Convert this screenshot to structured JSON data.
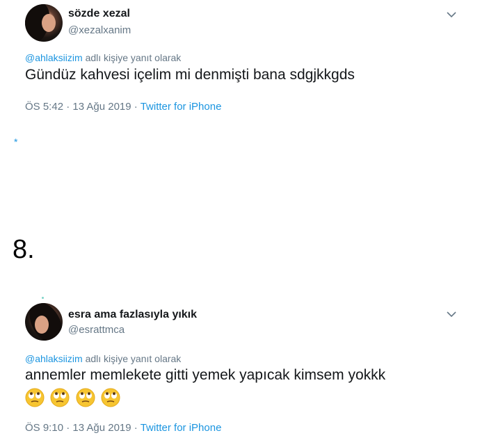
{
  "tweets": [
    {
      "name": "sözde xezal",
      "handle": "@xezalxanim",
      "reply_mention": "@ahlaksiizim",
      "reply_suffix": " adlı kişiye yanıt olarak",
      "text": "Gündüz kahvesi içelim mi denmişti bana sdgjkkgds",
      "time": "ÖS 5:42 · 13 Ağu 2019 · ",
      "source": "Twitter for iPhone"
    },
    {
      "name": "esra ama fazlasıyla yıkık",
      "handle": "@esrattmca",
      "reply_mention": "@ahlaksiizim",
      "reply_suffix": " adlı kişiye yanıt olarak",
      "text": "annemler memlekete gitti yemek yapıcak kimsem yokkk",
      "emoji": [
        "face-with-rolling-eyes",
        "face-with-rolling-eyes",
        "face-with-rolling-eyes",
        "face-with-rolling-eyes"
      ],
      "time": "ÖS 9:10 · 13 Ağu 2019 · ",
      "source": "Twitter for iPhone"
    }
  ],
  "separator": {
    "star": "*",
    "number": "8."
  },
  "colors": {
    "link": "#1b95e0",
    "muted": "#657786",
    "text": "#14171a"
  }
}
